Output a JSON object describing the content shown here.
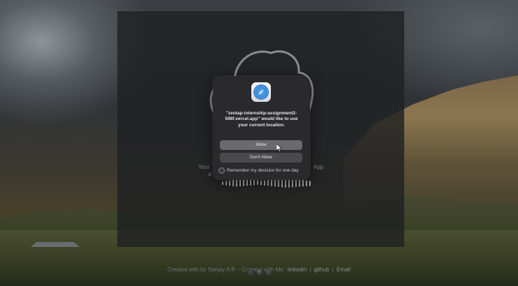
{
  "page": {
    "text_left": "Your",
    "text_left_2": "a",
    "text_right": "App",
    "footer": {
      "created": "Created with by Sanjay A R",
      "connect": "- Connect with Me:",
      "links": [
        "linkedin",
        "github",
        "Email"
      ],
      "separator": "|"
    }
  },
  "dialog": {
    "site": "\"zeotap-internship-assignment2-598f.vercel.app\"",
    "message": "would like to use your current location.",
    "allow_label": "Allow",
    "deny_label": "Don't Allow",
    "remember_label": "Remember my decision for one day",
    "remember_checked": false,
    "icon": "safari-compass-icon"
  },
  "colors": {
    "dialog_bg": "#2a2a2c",
    "allow_bg": "#6a6a6c",
    "deny_bg": "#4a4a4c"
  }
}
